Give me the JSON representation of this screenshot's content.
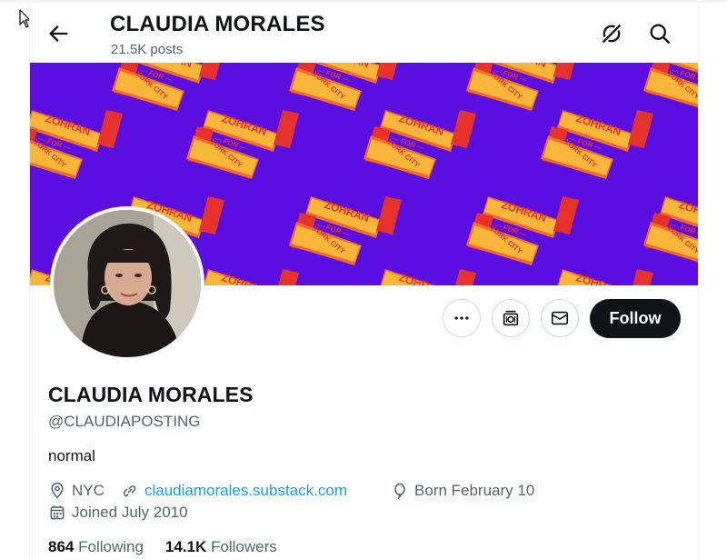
{
  "header": {
    "title": "CLAUDIA MORALES",
    "post_count": "21.5K posts"
  },
  "banner": {
    "background_color": "#5a0ee0",
    "pattern_text": {
      "top": "ZOHRAN",
      "middle": "FOR",
      "bottom": "NEW YORK CITY"
    },
    "accent_colors": {
      "orange": "#f26b2a",
      "yellow": "#f8b63a",
      "red": "#e6322d"
    }
  },
  "profile": {
    "display_name": "CLAUDIA MORALES",
    "handle": "@CLAUDIAPOSTING",
    "bio": "normal",
    "location": "NYC",
    "website": "claudiamorales.substack.com",
    "birthday": "Born February 10",
    "joined": "Joined July 2010"
  },
  "actions": {
    "follow_label": "Follow",
    "more_icon": "more-horizontal-icon",
    "subscribe_icon": "subscribe-icon",
    "message_icon": "envelope-icon"
  },
  "stats": {
    "following_count": "864",
    "following_label": "Following",
    "followers_count": "14.1K",
    "followers_label": "Followers"
  },
  "colors": {
    "accent": "#1d9bf0",
    "text": "#0f1419",
    "muted": "#536471",
    "button": "#0f1419"
  }
}
